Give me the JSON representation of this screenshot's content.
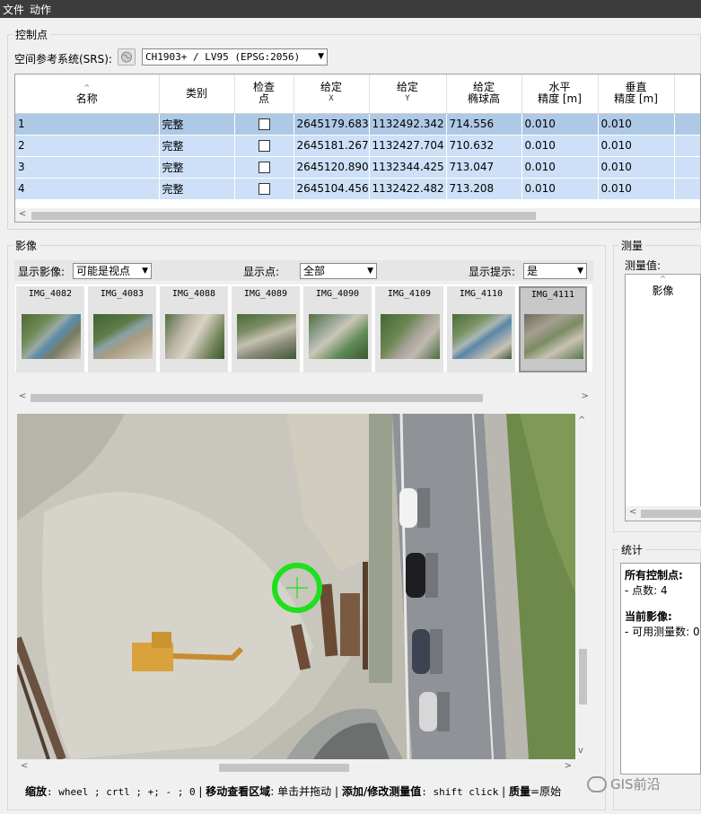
{
  "menu": {
    "file": "文件",
    "action": "动作"
  },
  "control_points": {
    "title": "控制点",
    "srs_label": "空间参考系统(SRS):",
    "srs_value": "CH1903+ / LV95 (EPSG:2056)",
    "columns": [
      {
        "label": "名称",
        "sub": ""
      },
      {
        "label": "类别",
        "sub": ""
      },
      {
        "label": "检查",
        "sub": "点"
      },
      {
        "label": "给定",
        "sub": "X"
      },
      {
        "label": "给定",
        "sub": "Y"
      },
      {
        "label": "给定",
        "sub": "椭球高"
      },
      {
        "label": "水平",
        "sub": "精度 [m]"
      },
      {
        "label": "垂直",
        "sub": "精度 [m]"
      }
    ],
    "rows": [
      {
        "name": "1",
        "type": "完整",
        "x": "2645179.683",
        "y": "1132492.342",
        "h": "714.556",
        "hacc": "0.010",
        "vacc": "0.010"
      },
      {
        "name": "2",
        "type": "完整",
        "x": "2645181.267",
        "y": "1132427.704",
        "h": "710.632",
        "hacc": "0.010",
        "vacc": "0.010"
      },
      {
        "name": "3",
        "type": "完整",
        "x": "2645120.890",
        "y": "1132344.425",
        "h": "713.047",
        "hacc": "0.010",
        "vacc": "0.010"
      },
      {
        "name": "4",
        "type": "完整",
        "x": "2645104.456",
        "y": "1132422.482",
        "h": "713.208",
        "hacc": "0.010",
        "vacc": "0.010"
      }
    ]
  },
  "images": {
    "title": "影像",
    "show_images_label": "显示影像:",
    "show_images_value": "可能是视点",
    "show_points_label": "显示点:",
    "show_points_value": "全部",
    "show_hints_label": "显示提示:",
    "show_hints_value": "是",
    "thumbnails": [
      "IMG_4082",
      "IMG_4083",
      "IMG_4088",
      "IMG_4089",
      "IMG_4090",
      "IMG_4109",
      "IMG_4110",
      "IMG_4111"
    ]
  },
  "measure": {
    "title": "测量",
    "values_label": "测量值:",
    "column": "影像"
  },
  "stats": {
    "title": "统计",
    "all_gcp": "所有控制点:",
    "points": "- 点数: 4",
    "current_image": "当前影像:",
    "available": "- 可用测量数: 0"
  },
  "status": {
    "zoom_label": "缩放",
    "zoom_keys": ": wheel ; crtl ; +; - ; 0",
    "move_label": "移动查看区域",
    "move_desc": ": 单击并拖动",
    "add_label": "添加/修改测量值",
    "add_keys": ": shift click",
    "quality_label": "质量",
    "quality_desc": "=原始"
  },
  "watermark": "GIS前沿",
  "colors": {
    "selected_row": "#aec9e6",
    "row": "#cde0f7",
    "marker": "#1ee01e",
    "menubar": "#3c3c3c"
  }
}
